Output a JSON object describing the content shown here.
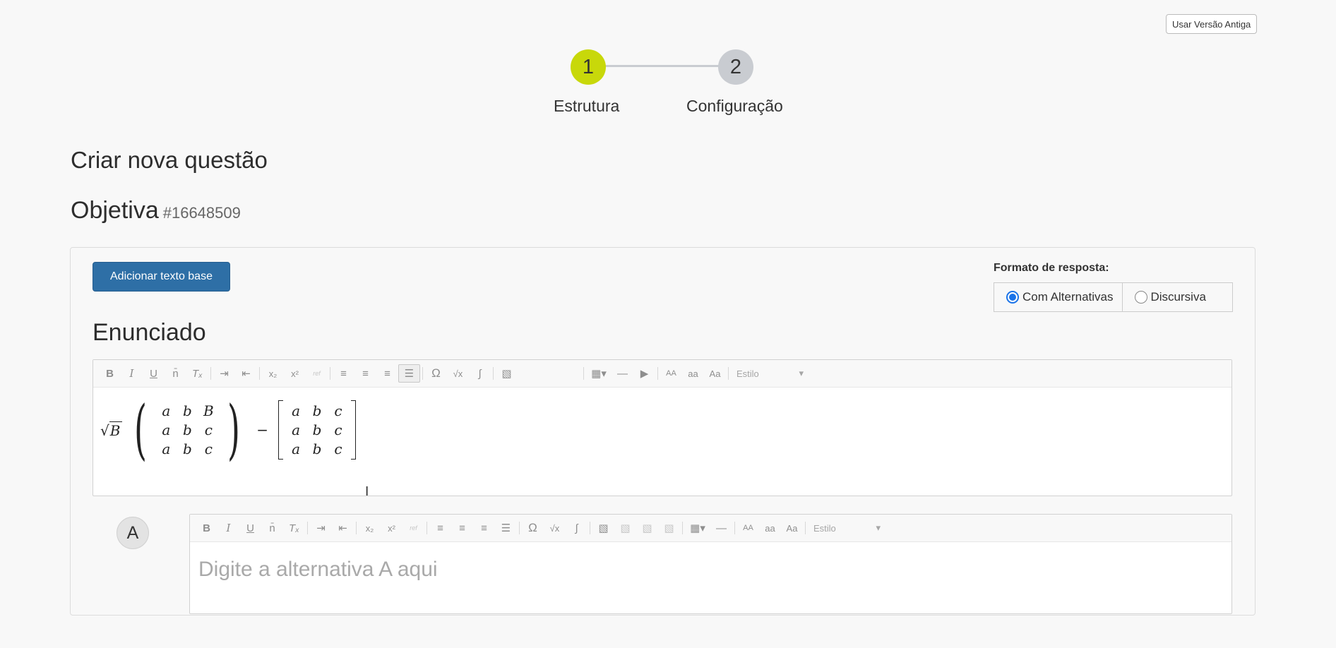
{
  "header": {
    "old_version_label": "Usar Versão Antiga"
  },
  "stepper": {
    "steps": [
      {
        "number": "1",
        "label": "Estrutura",
        "color": "#c8d80a"
      },
      {
        "number": "2",
        "label": "Configuração",
        "color": "#c9ccd1"
      }
    ]
  },
  "page": {
    "title": "Criar nova questão",
    "type": "Objetiva",
    "question_id": "#16648509"
  },
  "actions": {
    "add_base_text_label": "Adicionar texto base"
  },
  "format": {
    "label": "Formato de resposta:",
    "options": [
      {
        "label": "Com Alternativas",
        "selected": true
      },
      {
        "label": "Discursiva",
        "selected": false
      }
    ]
  },
  "statement": {
    "title": "Enunciado",
    "formula": {
      "sqrt_radicand": "B",
      "matrix1": [
        "a",
        "b",
        "B",
        "a",
        "b",
        "c",
        "a",
        "b",
        "c"
      ],
      "operator": "−",
      "matrix2": [
        "a",
        "b",
        "c",
        "a",
        "b",
        "c",
        "a",
        "b",
        "c"
      ]
    }
  },
  "toolbar": {
    "main_icons": [
      "bold-icon",
      "italic-icon",
      "underline-icon",
      "overline-icon",
      "remove-format-icon",
      "indent-icon",
      "outdent-icon",
      "subscript-icon",
      "superscript-icon",
      "reference-icon",
      "align-left-icon",
      "align-center-icon",
      "align-right-icon",
      "align-justify-icon",
      "special-char-icon",
      "sqrt-icon",
      "math-editor-icon",
      "image-icon",
      "table-icon",
      "horizontal-line-icon",
      "video-icon",
      "uppercase-icon",
      "lowercase-icon",
      "capitalize-icon"
    ],
    "glyphs": {
      "bold": "B",
      "italic": "I",
      "underline": "U",
      "overline": "n̄",
      "remove_format": "Tₓ",
      "indent": "⇥",
      "outdent": "⇤",
      "subscript": "x₂",
      "superscript": "x²",
      "reference": "ref",
      "align_left": "≡",
      "align_center": "≡",
      "align_right": "≡",
      "align_justify": "☰",
      "omega": "Ω",
      "sqrt": "√x",
      "formula": "∫",
      "image": "▧",
      "table": "▦▾",
      "hline": "—",
      "video": "▶",
      "upper": "AA",
      "lower": "aa",
      "cap": "Aa"
    },
    "style_label": "Estilo",
    "style_caret": "▾"
  },
  "alternative": {
    "letter": "A",
    "placeholder": "Digite a alternativa A aqui"
  },
  "colors": {
    "accent_step": "#c8d80a",
    "primary_button": "#2e6fa6",
    "radio_selected": "#1a73e8"
  },
  "cursor": {
    "glyph": "I"
  }
}
